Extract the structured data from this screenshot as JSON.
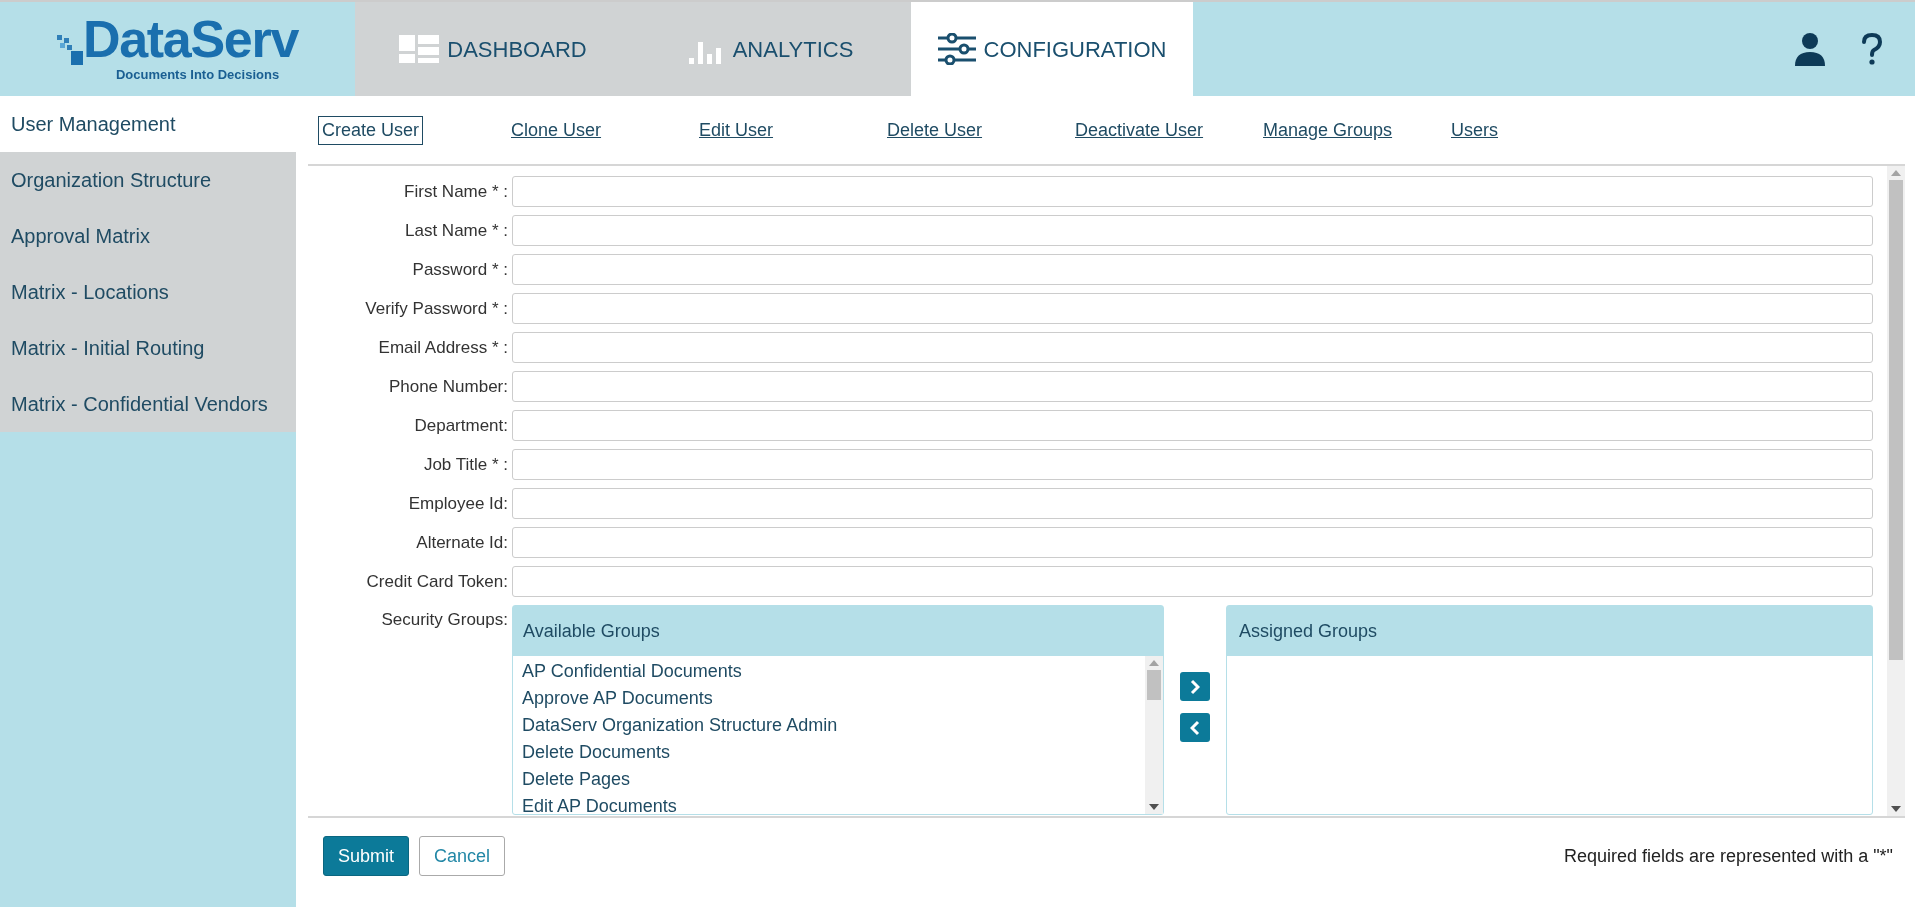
{
  "logo": {
    "name": "DataServ",
    "tagline": "Documents Into Decisions"
  },
  "nav_tabs": [
    {
      "label": "DASHBOARD",
      "selected": false
    },
    {
      "label": "ANALYTICS",
      "selected": false
    },
    {
      "label": "CONFIGURATION",
      "selected": true
    }
  ],
  "sidebar": {
    "items": [
      {
        "label": "User Management",
        "selected": true
      },
      {
        "label": "Organization Structure",
        "selected": false
      },
      {
        "label": "Approval Matrix",
        "selected": false
      },
      {
        "label": "Matrix - Locations",
        "selected": false
      },
      {
        "label": "Matrix - Initial Routing",
        "selected": false
      },
      {
        "label": "Matrix - Confidential Vendors",
        "selected": false
      }
    ]
  },
  "actions": [
    {
      "label": "Create User",
      "selected": true
    },
    {
      "label": "Clone User",
      "selected": false
    },
    {
      "label": "Edit User",
      "selected": false
    },
    {
      "label": "Delete User",
      "selected": false
    },
    {
      "label": "Deactivate User",
      "selected": false
    },
    {
      "label": "Manage Groups",
      "selected": false
    },
    {
      "label": "Users",
      "selected": false
    }
  ],
  "form": {
    "fields": [
      {
        "label": "First Name * :"
      },
      {
        "label": "Last Name * :"
      },
      {
        "label": "Password * :"
      },
      {
        "label": "Verify Password * :"
      },
      {
        "label": "Email Address * :"
      },
      {
        "label": "Phone Number:"
      },
      {
        "label": "Department:"
      },
      {
        "label": "Job Title * :"
      },
      {
        "label": "Employee Id:"
      },
      {
        "label": "Alternate Id:"
      },
      {
        "label": "Credit Card Token:"
      }
    ],
    "security_groups": {
      "label": "Security Groups:",
      "available_title": "Available Groups",
      "available": [
        "AP Confidential Documents",
        "Approve AP Documents",
        "DataServ Organization Structure Admin",
        "Delete Documents",
        "Delete Pages",
        "Edit AP Documents"
      ],
      "assigned_title": "Assigned Groups"
    }
  },
  "buttons": {
    "submit": "Submit",
    "cancel": "Cancel"
  },
  "note": "Required fields are represented with a \"*\""
}
